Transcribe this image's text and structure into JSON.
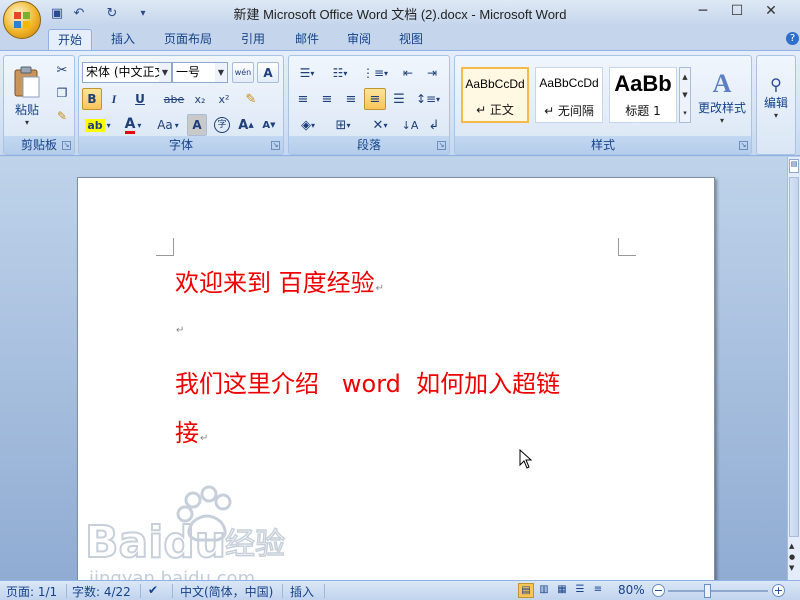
{
  "window": {
    "title": "新建 Microsoft Office Word 文档 (2).docx - Microsoft Word",
    "minimize": "─",
    "maximize": "☐",
    "close": "✕"
  },
  "qat": {
    "save": "▣",
    "undo": "↶",
    "redo": "↻",
    "customize": "▾"
  },
  "tabs": [
    "开始",
    "插入",
    "页面布局",
    "引用",
    "邮件",
    "审阅",
    "视图"
  ],
  "ribbon": {
    "clipboard": {
      "label": "剪贴板",
      "paste": "粘贴"
    },
    "font": {
      "label": "字体",
      "font_name": "宋体 (中文正文",
      "font_size": "一号",
      "bold": "B",
      "italic": "I",
      "underline": "U",
      "strike": "abe",
      "subscript": "x₂",
      "superscript": "x²",
      "change_case": "Aa",
      "grow": "A",
      "shrink": "A",
      "phonetic": "wén",
      "border": "A",
      "shade": "A",
      "enclose": "字"
    },
    "paragraph": {
      "label": "段落"
    },
    "styles": {
      "label": "样式",
      "items": [
        {
          "preview": "AaBbCcDd",
          "name": "↵ 正文"
        },
        {
          "preview": "AaBbCcDd",
          "name": "↵ 无间隔"
        },
        {
          "preview": "AaBb",
          "name": "标题 1"
        }
      ],
      "change_styles": "更改样式"
    },
    "editing": {
      "label": "编辑"
    }
  },
  "document": {
    "lines": [
      "欢迎来到 百度经验",
      "",
      "我们这里介绍   word  如何加入超链",
      "接"
    ],
    "para_mark": "↵"
  },
  "status": {
    "page": "页面: 1/1",
    "words": "字数: 4/22",
    "language": "中文(简体，中国)",
    "mode": "插入",
    "zoom": "80%"
  },
  "watermark": {
    "brand_text": "Baidu",
    "brand_cn": "经验",
    "url": "jingyan.baidu.com"
  },
  "colors": {
    "text_red": "#e00000",
    "accent_blue": "#15428b"
  }
}
